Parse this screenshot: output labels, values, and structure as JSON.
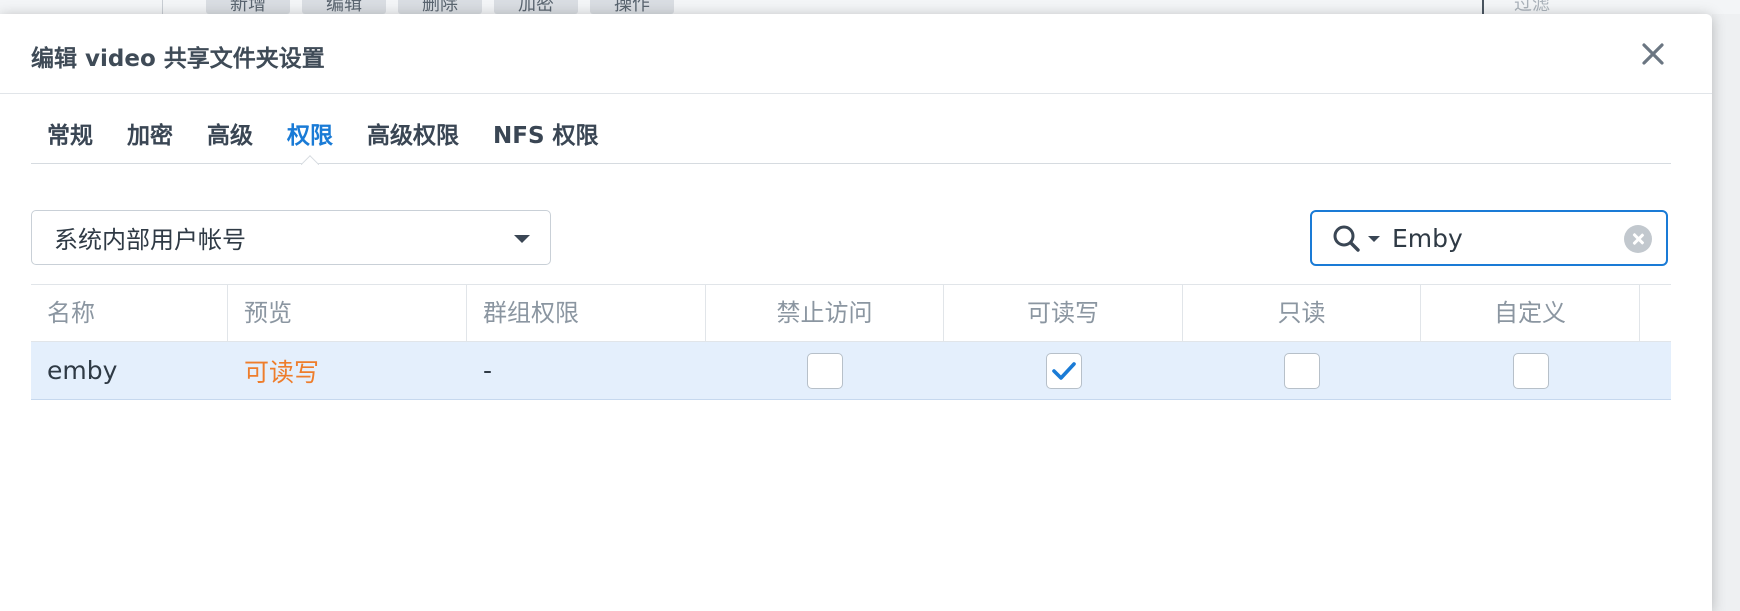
{
  "background": {
    "toolbar": [
      "新增",
      "编辑",
      "删除",
      "加密",
      "操作"
    ],
    "filter_placeholder": "过滤"
  },
  "dialog": {
    "title": "编辑 video 共享文件夹设置",
    "tabs": [
      {
        "label": "常规",
        "active": false
      },
      {
        "label": "加密",
        "active": false
      },
      {
        "label": "高级",
        "active": false
      },
      {
        "label": "权限",
        "active": true
      },
      {
        "label": "高级权限",
        "active": false
      },
      {
        "label": "NFS 权限",
        "active": false
      }
    ],
    "user_type_select": {
      "value": "系统内部用户帐号"
    },
    "search": {
      "value": "Emby"
    },
    "table": {
      "headers": {
        "name": "名称",
        "preview": "预览",
        "group_perm": "群组权限",
        "no_access": "禁止访问",
        "read_write": "可读写",
        "read_only": "只读",
        "custom": "自定义"
      },
      "rows": [
        {
          "name": "emby",
          "preview": "可读写",
          "group_perm": "-",
          "no_access": false,
          "read_write": true,
          "read_only": false,
          "custom": false
        }
      ]
    }
  },
  "colors": {
    "accent": "#1a7bd6",
    "preview_orange": "#ee7d2b",
    "row_selected": "#e4effc"
  }
}
